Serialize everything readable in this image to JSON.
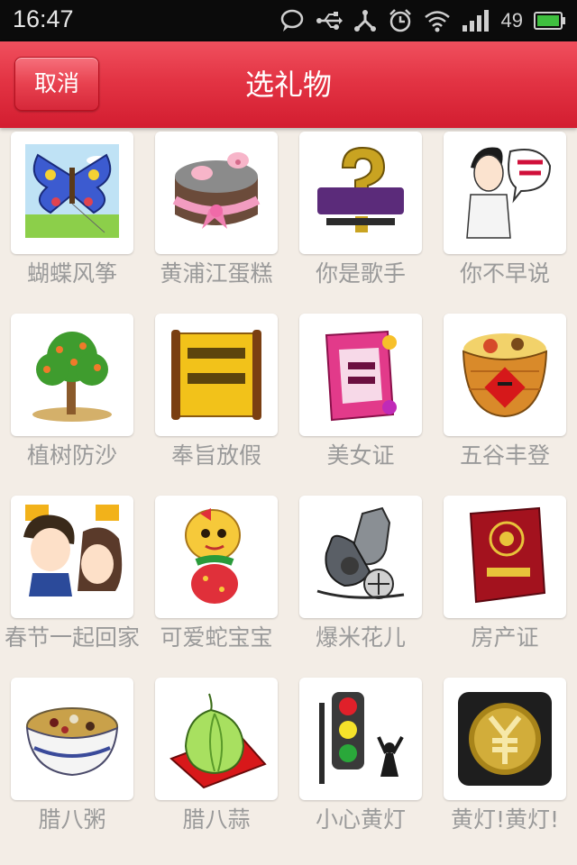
{
  "status_bar": {
    "time": "16:47",
    "battery": "49",
    "icons": [
      "chat-bubble-icon",
      "usb-icon",
      "share-icon",
      "alarm-icon",
      "wifi-icon",
      "signal-icon",
      "battery-icon"
    ]
  },
  "header": {
    "cancel_label": "取消",
    "title": "选礼物"
  },
  "gifts": [
    {
      "name": "蝴蝶风筝",
      "icon": "butterfly-kite-icon"
    },
    {
      "name": "黄浦江蛋糕",
      "icon": "pig-cake-icon"
    },
    {
      "name": "你是歌手",
      "icon": "singer-logo-icon"
    },
    {
      "name": "你不早说",
      "icon": "cartoon-man-icon"
    },
    {
      "name": "植树防沙",
      "icon": "tree-icon"
    },
    {
      "name": "奉旨放假",
      "icon": "scroll-icon"
    },
    {
      "name": "美女证",
      "icon": "beauty-certificate-icon"
    },
    {
      "name": "五谷丰登",
      "icon": "grain-basket-icon"
    },
    {
      "name": "春节一起回家",
      "icon": "couple-icon"
    },
    {
      "name": "可爱蛇宝宝",
      "icon": "snake-icon"
    },
    {
      "name": "爆米花儿",
      "icon": "popcorn-machine-icon"
    },
    {
      "name": "房产证",
      "icon": "property-certificate-icon"
    },
    {
      "name": "腊八粥",
      "icon": "porridge-bowl-icon"
    },
    {
      "name": "腊八蒜",
      "icon": "garlic-icon"
    },
    {
      "name": "小心黄灯",
      "icon": "traffic-light-icon"
    },
    {
      "name": "黄灯!黄灯!",
      "icon": "yellow-light-icon"
    }
  ]
}
